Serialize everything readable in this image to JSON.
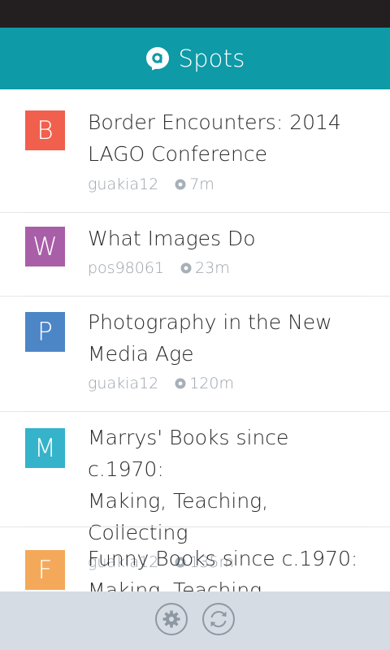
{
  "header": {
    "title": "Spots"
  },
  "spots": [
    {
      "letter": "B",
      "color": "#f0604d",
      "title_lines": [
        "Border Encounters: 2014",
        "LAGO Conference"
      ],
      "user": "guakia12",
      "distance": "7m"
    },
    {
      "letter": "W",
      "color": "#a95ea8",
      "title_lines": [
        "What Images Do"
      ],
      "user": "pos98061",
      "distance": "23m"
    },
    {
      "letter": "P",
      "color": "#4d86c6",
      "title_lines": [
        "Photography in the New",
        "Media Age"
      ],
      "user": "guakia12",
      "distance": "120m"
    },
    {
      "letter": "M",
      "color": "#35b3ca",
      "title_lines": [
        "Marrys' Books since c.1970:",
        "Making, Teaching, Collecting"
      ],
      "user": "guakia12",
      "distance": "135m"
    },
    {
      "letter": "F",
      "color": "#f4a95a",
      "title_lines": [
        "Funny Books since c.1970:",
        "Making, Teaching, Collecting"
      ],
      "user": "",
      "distance": ""
    }
  ],
  "app_bar": {
    "buttons": [
      {
        "icon": "settings-icon"
      },
      {
        "icon": "refresh-icon"
      }
    ]
  }
}
